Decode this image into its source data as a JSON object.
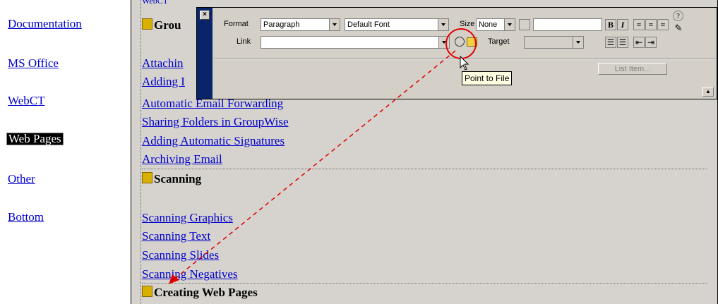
{
  "nav": {
    "items": [
      {
        "label": "Documentation"
      },
      {
        "label": "MS Office"
      },
      {
        "label": "WebCT"
      },
      {
        "label": "Web Pages",
        "selected": true
      },
      {
        "label": "Other"
      },
      {
        "label": "Bottom"
      }
    ]
  },
  "content": {
    "cut_top_link": "WebCT",
    "group_heading_partial": "Grou",
    "groupwise_links": [
      "Attachin",
      "Adding I",
      "Automatic Email Forwarding",
      "Sharing Folders in GroupWise",
      "Adding Automatic Signatures",
      "Archiving Email"
    ],
    "scanning_heading": "Scanning",
    "scanning_links": [
      "Scanning Graphics",
      "Scanning Text",
      "Scanning Slides",
      "Scanning Negatives"
    ],
    "webpages_heading": "Creating Web Pages"
  },
  "panel": {
    "close_glyph": "×",
    "format_label": "Format",
    "format_value": "Paragraph",
    "font_value": "Default Font",
    "size_label": "Size",
    "size_value": "None",
    "bold": "B",
    "italic": "I",
    "link_label": "Link",
    "link_value": "",
    "target_label": "Target",
    "target_value": "",
    "list_item_button": "List Item...",
    "help_glyph": "?",
    "expand_glyph": "▲"
  },
  "tooltip": "Point to File",
  "colors": {
    "annotation": "#e00000",
    "link": "#0000cc",
    "panel_bg": "#d4d0c8",
    "content_bg": "#d6d3ce"
  }
}
